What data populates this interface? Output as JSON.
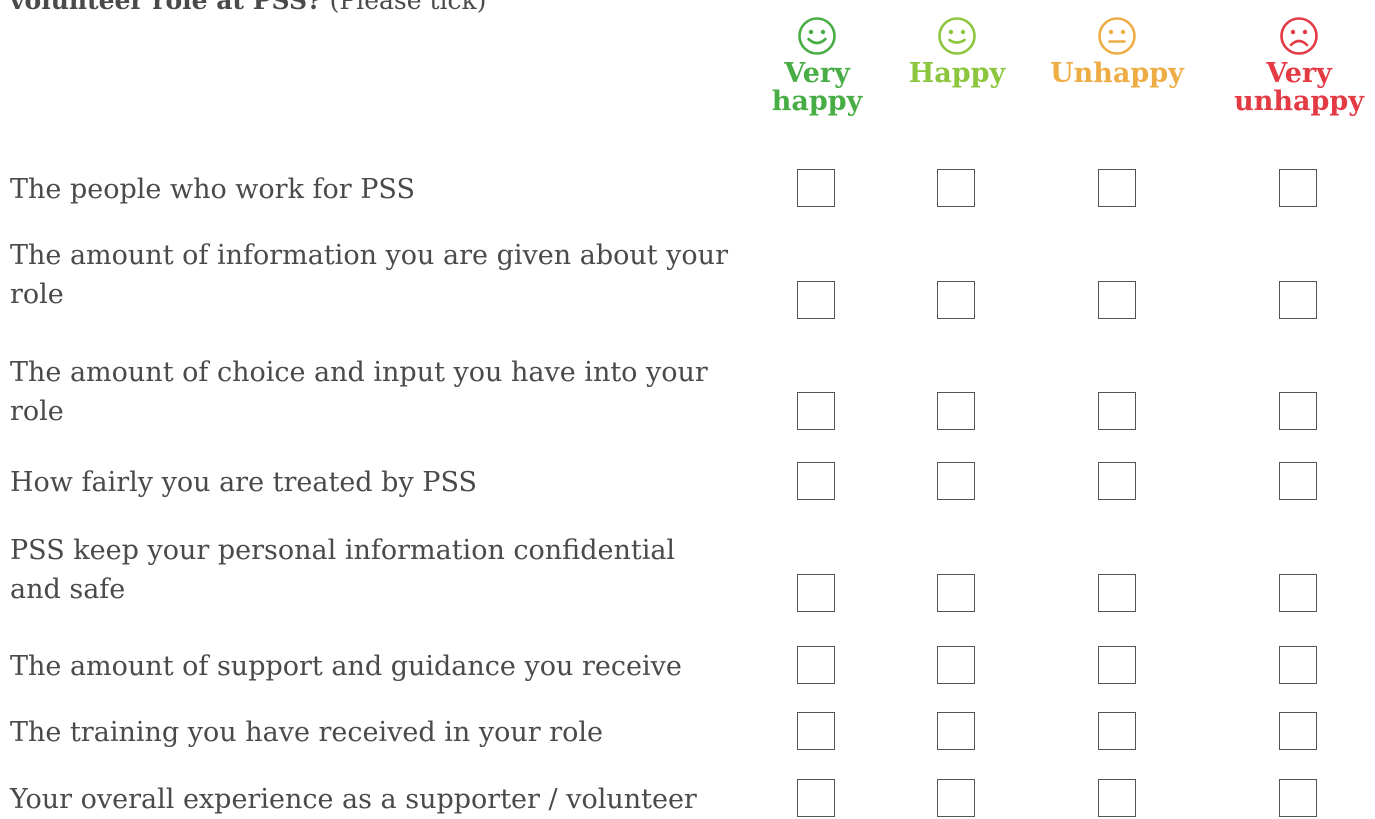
{
  "question": {
    "bold_text": "volunteer role at PSS?",
    "normal_text": " (Please tick)"
  },
  "ratings": [
    {
      "label": "Very happy",
      "icon": "very-happy-face-icon",
      "color": "#48ad44"
    },
    {
      "label": "Happy",
      "icon": "happy-face-icon",
      "color": "#8cc63e"
    },
    {
      "label": "Unhappy",
      "icon": "unhappy-face-icon",
      "color": "#eeac45"
    },
    {
      "label": "Very unhappy",
      "icon": "very-unhappy-face-icon",
      "color": "#e33a44"
    }
  ],
  "statements": [
    "The people who work for PSS",
    "The amount of information you are given about your role",
    "The amount of choice and input you have into your role",
    "How fairly you are treated by PSS",
    "PSS keep your personal information confidential and safe",
    "The amount of support and guidance you receive",
    "The training you have received in your role",
    "Your overall experience as a supporter / volunteer"
  ]
}
